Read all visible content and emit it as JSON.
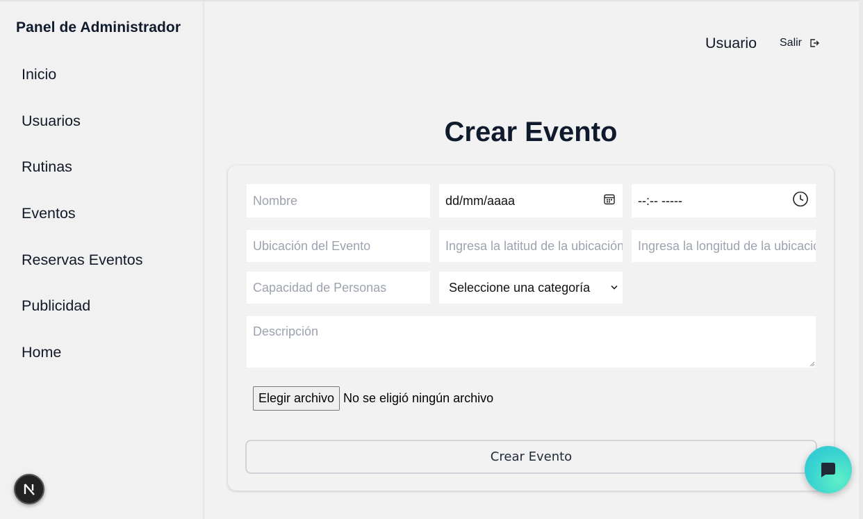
{
  "sidebar": {
    "title": "Panel de Administrador",
    "items": [
      {
        "label": "Inicio"
      },
      {
        "label": "Usuarios"
      },
      {
        "label": "Rutinas"
      },
      {
        "label": "Eventos"
      },
      {
        "label": "Reservas Eventos"
      },
      {
        "label": "Publicidad"
      },
      {
        "label": "Home"
      }
    ],
    "badge_letter": "N"
  },
  "header": {
    "user": "Usuario",
    "logout": "Salir"
  },
  "form": {
    "title": "Crear Evento",
    "name_placeholder": "Nombre",
    "date_value": "dd/mm/aaaa",
    "time_value": "--:-- -----",
    "location_placeholder": "Ubicación del Evento",
    "lat_placeholder": "Ingresa la latitud de la ubicación",
    "lng_placeholder": "Ingresa la longitud de la ubicación",
    "capacity_placeholder": "Capacidad de Personas",
    "category_selected": "Seleccione una categoría",
    "description_placeholder": "Descripción",
    "file_button": "Elegir archivo",
    "file_status": "No se eligió ningún archivo",
    "submit": "Crear Evento"
  },
  "colors": {
    "background": "#f2f2f2",
    "title": "#0f1b2d",
    "placeholder": "#9ca3af",
    "chat_fab": "#3ad4d0"
  }
}
